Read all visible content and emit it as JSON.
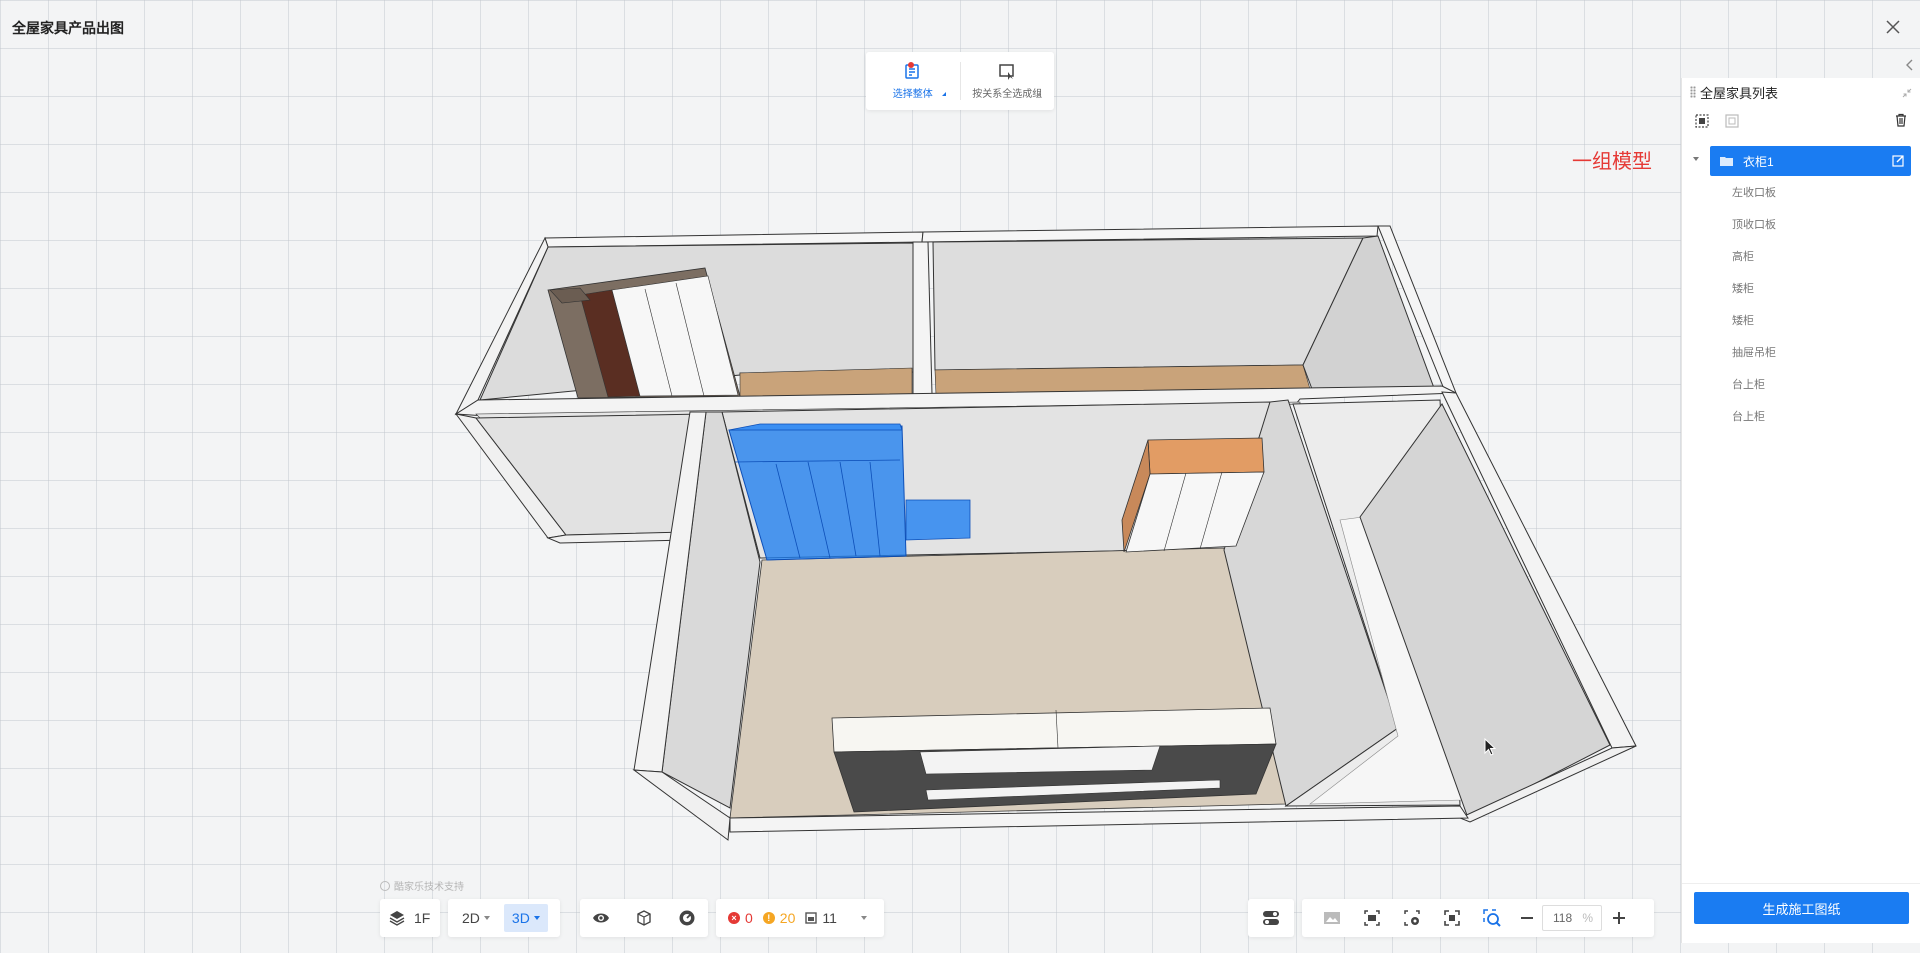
{
  "app": {
    "title": "全屋家具产品出图"
  },
  "top_toolbar": {
    "tools": [
      {
        "label": "选择整体",
        "icon": "select-whole-icon",
        "active": true
      },
      {
        "label": "按关系全选成组",
        "icon": "select-group-icon",
        "active": false
      }
    ]
  },
  "annotation": {
    "text": "一组模型",
    "color": "#e53935"
  },
  "panel": {
    "title": "全屋家具列表",
    "root": {
      "label": "衣柜1"
    },
    "children": [
      "左收口板",
      "顶收口板",
      "高柜",
      "矮柜",
      "矮柜",
      "抽屉吊柜",
      "台上柜",
      "台上柜"
    ],
    "generate_button": "生成施工图纸"
  },
  "bottom_toolbar": {
    "support_text": "酷家乐技术支持",
    "floor": "1F",
    "view_2d": "2D",
    "view_3d": "3D",
    "error_count": "0",
    "warning_count": "20",
    "model_count": "11",
    "zoom_value": "118",
    "zoom_unit": "%"
  },
  "colors": {
    "accent": "#1a7cf2",
    "error": "#e53935",
    "warning": "#f5a623",
    "selected_cabinet": "#1f7ff0"
  }
}
